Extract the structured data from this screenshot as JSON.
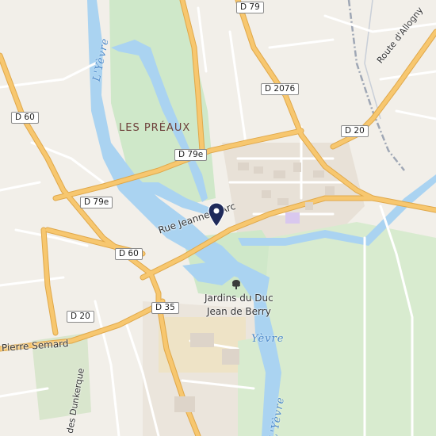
{
  "map": {
    "colors": {
      "land": "#f2efe9",
      "park": "#cfe8c9",
      "water": "#aad3f1",
      "road_major": "#f7c76f",
      "road_minor": "#ffffff",
      "building": "#e4dcd2",
      "marker": "#1f2a5a"
    },
    "place_labels": {
      "les_preaux": "LES PRÉAUX"
    },
    "road_shields": {
      "d79": "D 79",
      "d2076": "D 2076",
      "d60_top": "D 60",
      "d79e_mid": "D 79e",
      "d79e_left": "D 79e",
      "d20_right": "D 20",
      "d60_mid": "D 60",
      "d35": "D 35",
      "d20_left": "D 20"
    },
    "street_labels": {
      "rue_jeanne_arc": "Rue Jeanne d'Arc",
      "route_allogny": "Route d'Allogny",
      "pierre_semard": "Pierre Semard",
      "des_dunkerque": "des Dunkerque"
    },
    "water_labels": {
      "yevre_top": "L'Yèvre",
      "yevre_center": "Yèvre",
      "yevre_bottom": "L'Yèvre"
    },
    "poi": {
      "line1": "Jardins du Duc",
      "line2": "Jean de Berry",
      "icon": "tree-icon"
    },
    "marker": {
      "icon": "location-pin-icon"
    }
  }
}
